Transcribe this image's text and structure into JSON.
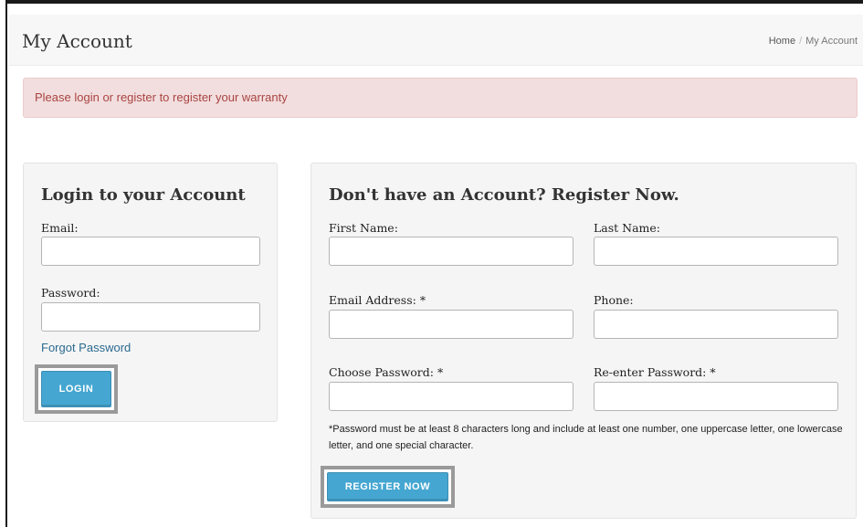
{
  "header": {
    "title": "My Account",
    "breadcrumb": [
      {
        "label": "Home"
      },
      {
        "label": "My Account"
      }
    ]
  },
  "alert": {
    "text": "Please login or register to register your warranty"
  },
  "login": {
    "title": "Login to your Account",
    "email_label": "Email:",
    "email_value": "",
    "password_label": "Password:",
    "password_value": "",
    "forgot_link": "Forgot Password",
    "submit_label": "LOGIN"
  },
  "register": {
    "title": "Don't have an Account? Register Now.",
    "first_name_label": "First Name:",
    "last_name_label": "Last Name:",
    "email_label": "Email Address: *",
    "phone_label": "Phone:",
    "password_label": "Choose Password: *",
    "reenter_password_label": "Re-enter Password: *",
    "password_note": "*Password must be at least 8 characters long and include at least one number, one uppercase letter, one lowercase letter, and one special character.",
    "submit_label": "REGISTER NOW"
  }
}
